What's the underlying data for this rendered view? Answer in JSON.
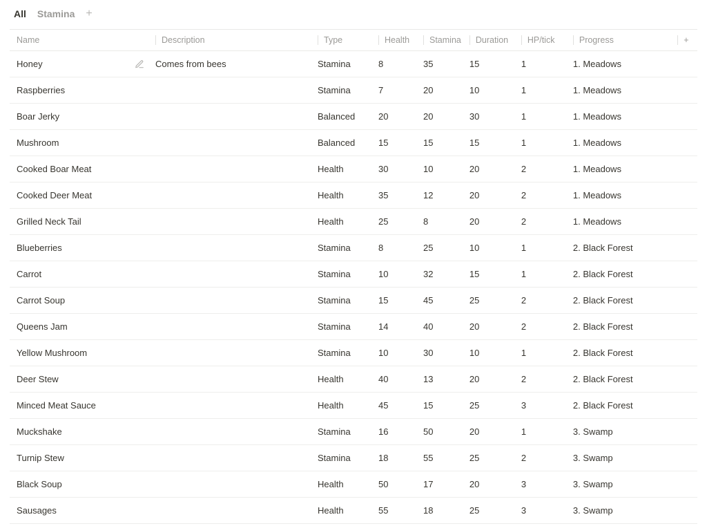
{
  "tabs": {
    "all": "All",
    "stamina": "Stamina"
  },
  "columns": {
    "name": "Name",
    "description": "Description",
    "type": "Type",
    "health": "Health",
    "stamina": "Stamina",
    "duration": "Duration",
    "hptick": "HP/tick",
    "progress": "Progress"
  },
  "type_colors": {
    "Stamina": "type-stamina",
    "Balanced": "type-balanced",
    "Health": "type-health"
  },
  "progress_colors": {
    "1. Meadows": "prog-meadows",
    "2. Black Forest": "prog-blackforest",
    "3. Swamp": "prog-swamp"
  },
  "rows": [
    {
      "name": "Honey",
      "description": "Comes from bees",
      "type": "Stamina",
      "health": 8,
      "stamina": 35,
      "duration": 15,
      "hptick": 1,
      "progress": "1. Meadows",
      "show_edit": true
    },
    {
      "name": "Raspberries",
      "description": "",
      "type": "Stamina",
      "health": 7,
      "stamina": 20,
      "duration": 10,
      "hptick": 1,
      "progress": "1. Meadows"
    },
    {
      "name": "Boar Jerky",
      "description": "",
      "type": "Balanced",
      "health": 20,
      "stamina": 20,
      "duration": 30,
      "hptick": 1,
      "progress": "1. Meadows"
    },
    {
      "name": "Mushroom",
      "description": "",
      "type": "Balanced",
      "health": 15,
      "stamina": 15,
      "duration": 15,
      "hptick": 1,
      "progress": "1. Meadows"
    },
    {
      "name": "Cooked Boar Meat",
      "description": "",
      "type": "Health",
      "health": 30,
      "stamina": 10,
      "duration": 20,
      "hptick": 2,
      "progress": "1. Meadows"
    },
    {
      "name": "Cooked Deer Meat",
      "description": "",
      "type": "Health",
      "health": 35,
      "stamina": 12,
      "duration": 20,
      "hptick": 2,
      "progress": "1. Meadows"
    },
    {
      "name": "Grilled Neck Tail",
      "description": "",
      "type": "Health",
      "health": 25,
      "stamina": 8,
      "duration": 20,
      "hptick": 2,
      "progress": "1. Meadows"
    },
    {
      "name": "Blueberries",
      "description": "",
      "type": "Stamina",
      "health": 8,
      "stamina": 25,
      "duration": 10,
      "hptick": 1,
      "progress": "2. Black Forest"
    },
    {
      "name": "Carrot",
      "description": "",
      "type": "Stamina",
      "health": 10,
      "stamina": 32,
      "duration": 15,
      "hptick": 1,
      "progress": "2. Black Forest"
    },
    {
      "name": "Carrot Soup",
      "description": "",
      "type": "Stamina",
      "health": 15,
      "stamina": 45,
      "duration": 25,
      "hptick": 2,
      "progress": "2. Black Forest"
    },
    {
      "name": "Queens Jam",
      "description": "",
      "type": "Stamina",
      "health": 14,
      "stamina": 40,
      "duration": 20,
      "hptick": 2,
      "progress": "2. Black Forest"
    },
    {
      "name": "Yellow Mushroom",
      "description": "",
      "type": "Stamina",
      "health": 10,
      "stamina": 30,
      "duration": 10,
      "hptick": 1,
      "progress": "2. Black Forest"
    },
    {
      "name": "Deer Stew",
      "description": "",
      "type": "Health",
      "health": 40,
      "stamina": 13,
      "duration": 20,
      "hptick": 2,
      "progress": "2. Black Forest"
    },
    {
      "name": "Minced Meat Sauce",
      "description": "",
      "type": "Health",
      "health": 45,
      "stamina": 15,
      "duration": 25,
      "hptick": 3,
      "progress": "2. Black Forest"
    },
    {
      "name": "Muckshake",
      "description": "",
      "type": "Stamina",
      "health": 16,
      "stamina": 50,
      "duration": 20,
      "hptick": 1,
      "progress": "3. Swamp"
    },
    {
      "name": "Turnip Stew",
      "description": "",
      "type": "Stamina",
      "health": 18,
      "stamina": 55,
      "duration": 25,
      "hptick": 2,
      "progress": "3. Swamp"
    },
    {
      "name": "Black Soup",
      "description": "",
      "type": "Health",
      "health": 50,
      "stamina": 17,
      "duration": 20,
      "hptick": 3,
      "progress": "3. Swamp"
    },
    {
      "name": "Sausages",
      "description": "",
      "type": "Health",
      "health": 55,
      "stamina": 18,
      "duration": 25,
      "hptick": 3,
      "progress": "3. Swamp"
    }
  ]
}
